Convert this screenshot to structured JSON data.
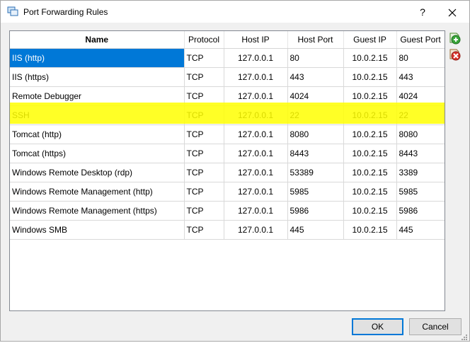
{
  "window": {
    "title": "Port Forwarding Rules",
    "help_label": "?",
    "close_label": "✕"
  },
  "table": {
    "columns": [
      "Name",
      "Protocol",
      "Host IP",
      "Host Port",
      "Guest IP",
      "Guest Port"
    ],
    "rows": [
      [
        "IIS (http)",
        "TCP",
        "127.0.0.1",
        "80",
        "10.0.2.15",
        "80"
      ],
      [
        "IIS (https)",
        "TCP",
        "127.0.0.1",
        "443",
        "10.0.2.15",
        "443"
      ],
      [
        "Remote Debugger",
        "TCP",
        "127.0.0.1",
        "4024",
        "10.0.2.15",
        "4024"
      ],
      [
        "SSH",
        "TCP",
        "127.0.0.1",
        "22",
        "10.0.2.15",
        "22"
      ],
      [
        "Tomcat (http)",
        "TCP",
        "127.0.0.1",
        "8080",
        "10.0.2.15",
        "8080"
      ],
      [
        "Tomcat (https)",
        "TCP",
        "127.0.0.1",
        "8443",
        "10.0.2.15",
        "8443"
      ],
      [
        "Windows Remote Desktop (rdp)",
        "TCP",
        "127.0.0.1",
        "53389",
        "10.0.2.15",
        "3389"
      ],
      [
        "Windows Remote Management (http)",
        "TCP",
        "127.0.0.1",
        "5985",
        "10.0.2.15",
        "5985"
      ],
      [
        "Windows Remote Management (https)",
        "TCP",
        "127.0.0.1",
        "5986",
        "10.0.2.15",
        "5986"
      ],
      [
        "Windows SMB",
        "TCP",
        "127.0.0.1",
        "445",
        "10.0.2.15",
        "445"
      ]
    ],
    "selected_row": 0,
    "highlighted_row": 3
  },
  "icons": {
    "app": "virtualbox-icon",
    "add": "add-rule-icon",
    "remove": "remove-rule-icon"
  },
  "colors": {
    "selection": "#0078d7",
    "highlight": "#ffff00",
    "add_green": "#3aa53a",
    "remove_red": "#d9342b"
  },
  "buttons": {
    "ok_label": "OK",
    "cancel_label": "Cancel"
  }
}
